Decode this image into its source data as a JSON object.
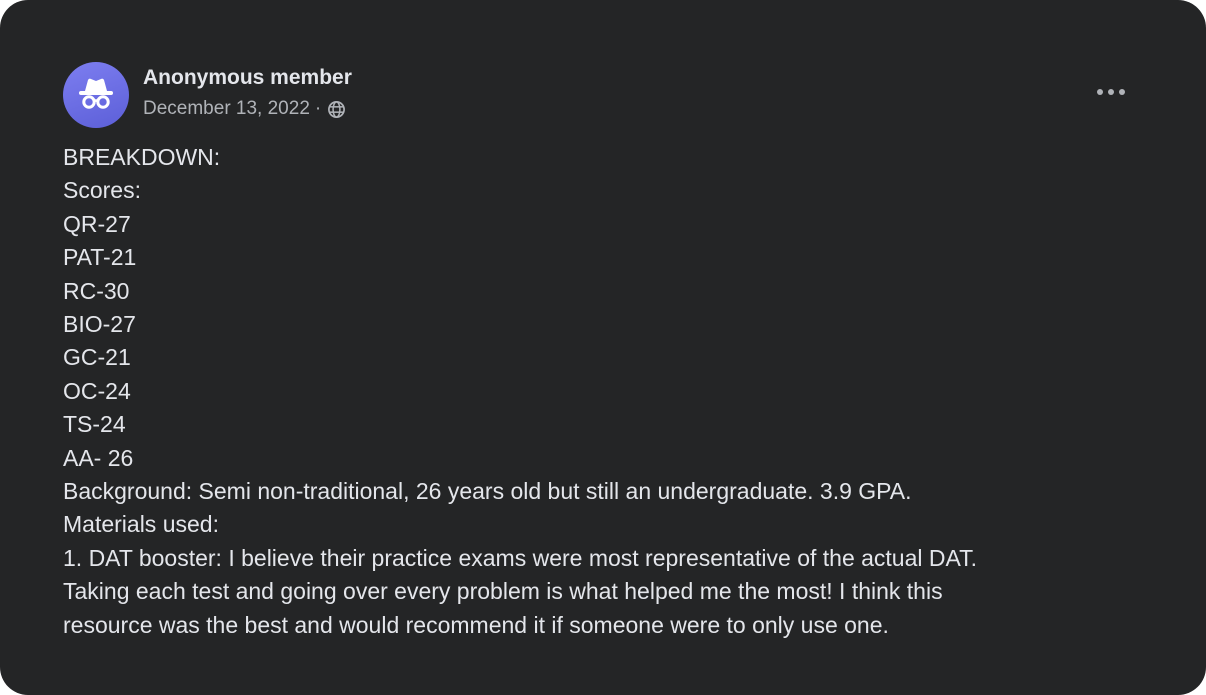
{
  "post": {
    "author": "Anonymous member",
    "date": "December 13, 2022",
    "separator": "·",
    "audience_icon": "globe-icon",
    "menu_icon": "more-horizontal-icon",
    "avatar_icon": "incognito-icon",
    "avatar_color": "#6b6ee6",
    "background_color": "#242526",
    "text_color": "#e4e6eb",
    "secondary_text_color": "#b0b3b8",
    "lines": [
      "BREAKDOWN:",
      "Scores:",
      "QR-27",
      "PAT-21",
      "RC-30",
      "BIO-27",
      "GC-21",
      "OC-24",
      "TS-24",
      "AA- 26",
      "Background: Semi non-traditional, 26 years old but still an undergraduate. 3.9 GPA.",
      "Materials used:",
      "1. DAT booster: I believe their practice exams were most representative of the actual DAT.",
      "Taking each test and going over every problem is what helped me the most! I think this",
      "resource was the best and would recommend it if someone were to only use one."
    ]
  }
}
